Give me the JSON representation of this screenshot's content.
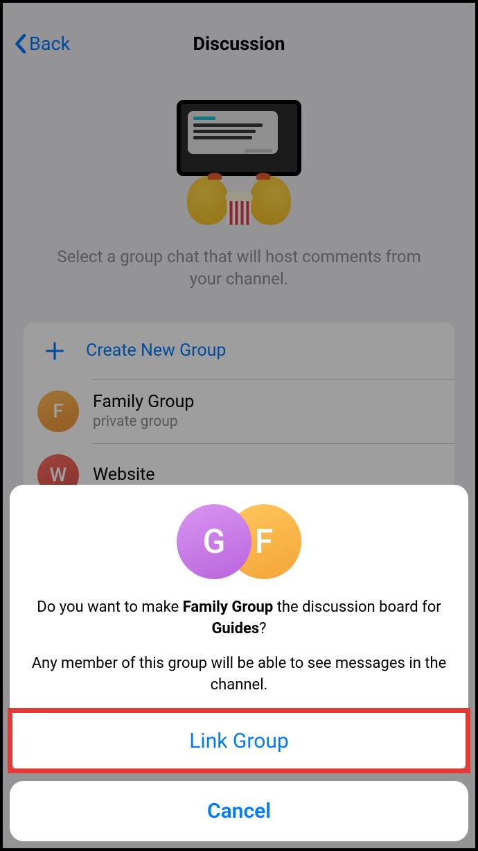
{
  "header": {
    "back_label": "Back",
    "title": "Discussion"
  },
  "description": "Select a group chat that will host comments from your channel.",
  "list": {
    "create_label": "Create New Group",
    "groups": [
      {
        "initial": "F",
        "name": "Family Group",
        "subtitle": "private group"
      },
      {
        "initial": "W",
        "name": "Website",
        "subtitle": ""
      }
    ]
  },
  "sheet": {
    "avatars": [
      {
        "initial": "G"
      },
      {
        "initial": "F"
      }
    ],
    "question_pre": "Do you want to make ",
    "question_group": "Family Group",
    "question_mid": " the discussion board for ",
    "question_channel": "Guides",
    "question_post": "?",
    "warning": "Any member of this group will be able to see messages in the channel.",
    "link_label": "Link Group",
    "cancel_label": "Cancel"
  }
}
